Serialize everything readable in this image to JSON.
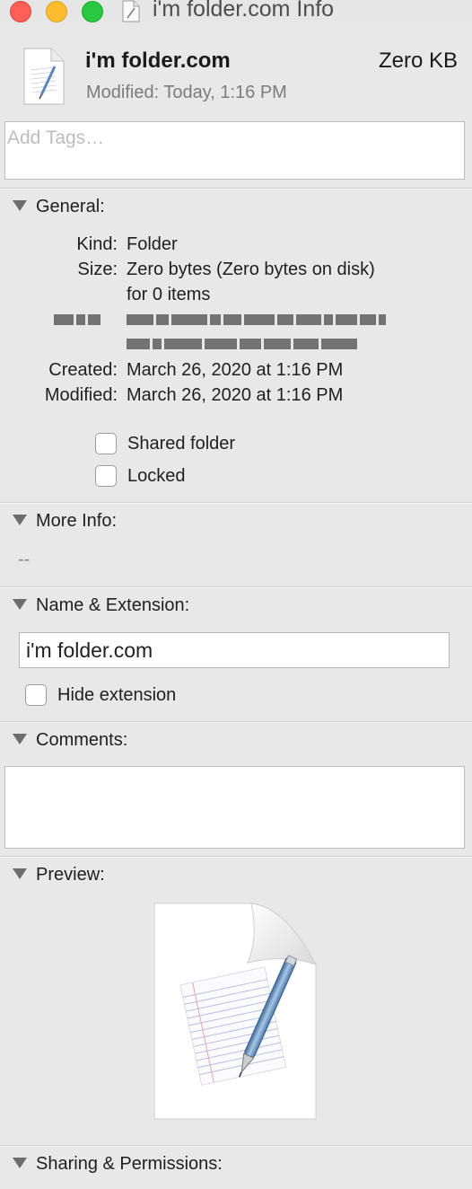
{
  "window": {
    "title": "i'm folder.com Info",
    "traffic_lights": {
      "close_color": "#fe5f57",
      "minimize_color": "#febc2e",
      "maximize_color": "#28c840"
    }
  },
  "header": {
    "icon": "document-icon",
    "name": "i'm folder.com",
    "size": "Zero KB",
    "modified": "Modified:  Today, 1:16 PM"
  },
  "tags": {
    "placeholder": "Add Tags…",
    "value": ""
  },
  "general": {
    "label": "General:",
    "kind_label": "Kind:",
    "kind_value": "Folder",
    "size_label": "Size:",
    "size_value": "Zero bytes (Zero bytes on disk)",
    "size_value2": "for 0 items",
    "created_label": "Created:",
    "created_value": "March 26, 2020 at 1:16 PM",
    "modified_label": "Modified:",
    "modified_value": "March 26, 2020 at 1:16 PM",
    "shared_folder_label": "Shared folder",
    "locked_label": "Locked"
  },
  "more_info": {
    "label": "More Info:",
    "value": "--"
  },
  "name_extension": {
    "label": "Name & Extension:",
    "value": "i'm folder.com",
    "hide_extension_label": "Hide extension"
  },
  "comments": {
    "label": "Comments:",
    "value": ""
  },
  "preview": {
    "label": "Preview:",
    "icon": "text-document-with-pen-icon"
  },
  "sharing": {
    "label": "Sharing & Permissions:"
  },
  "colors": {
    "background": "#e8e8e8",
    "triangle": "#6d6d6d",
    "secondary_text": "#7c7c7c"
  }
}
